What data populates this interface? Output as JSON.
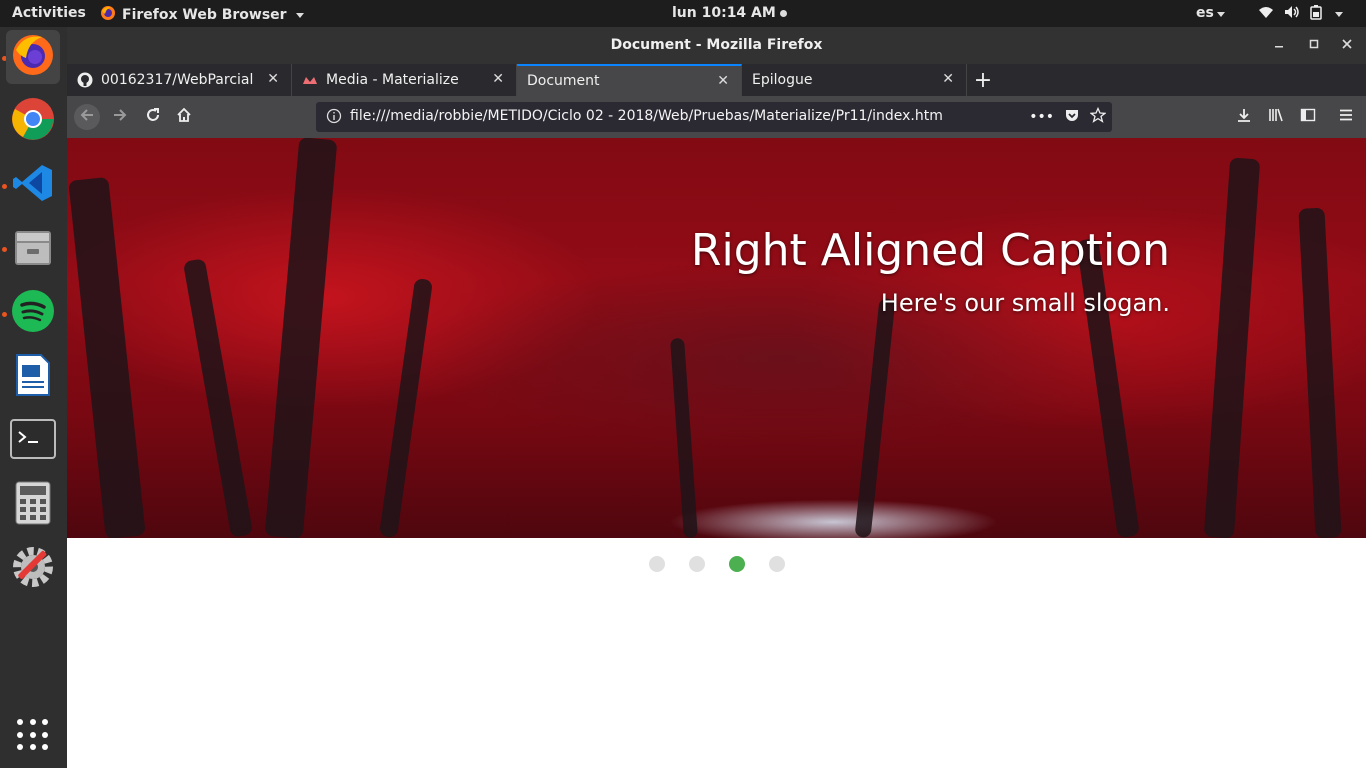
{
  "topbar": {
    "activities": "Activities",
    "app_name": "Firefox Web Browser",
    "clock": "lun 10:14 AM",
    "language": "es"
  },
  "dock": {
    "apps": [
      "firefox-icon",
      "chrome-icon",
      "vscode-icon",
      "file-manager-icon",
      "spotify-icon",
      "document-viewer-icon",
      "terminal-icon",
      "calculator-icon",
      "settings-icon"
    ],
    "show_apps": "apps-grid-icon"
  },
  "window": {
    "title": "Document - Mozilla Firefox"
  },
  "tabs": [
    {
      "label": "00162317/WebParcial",
      "icon": "github-icon"
    },
    {
      "label": "Media - Materialize",
      "icon": "materialize-icon"
    },
    {
      "label": "Document",
      "icon": ""
    },
    {
      "label": "Epilogue",
      "icon": ""
    }
  ],
  "navbar": {
    "url": "file:///media/robbie/METIDO/Ciclo 02 - 2018/Web/Pruebas/Materialize/Pr11/index.htm",
    "more_label": "•••"
  },
  "slider": {
    "caption_title": "Right Aligned Caption",
    "caption_subtitle": "Here's our small slogan.",
    "indicator_count": 4,
    "active_indicator": 3,
    "colors": {
      "active": "#4caf50",
      "inactive": "#e0e0e0"
    }
  }
}
